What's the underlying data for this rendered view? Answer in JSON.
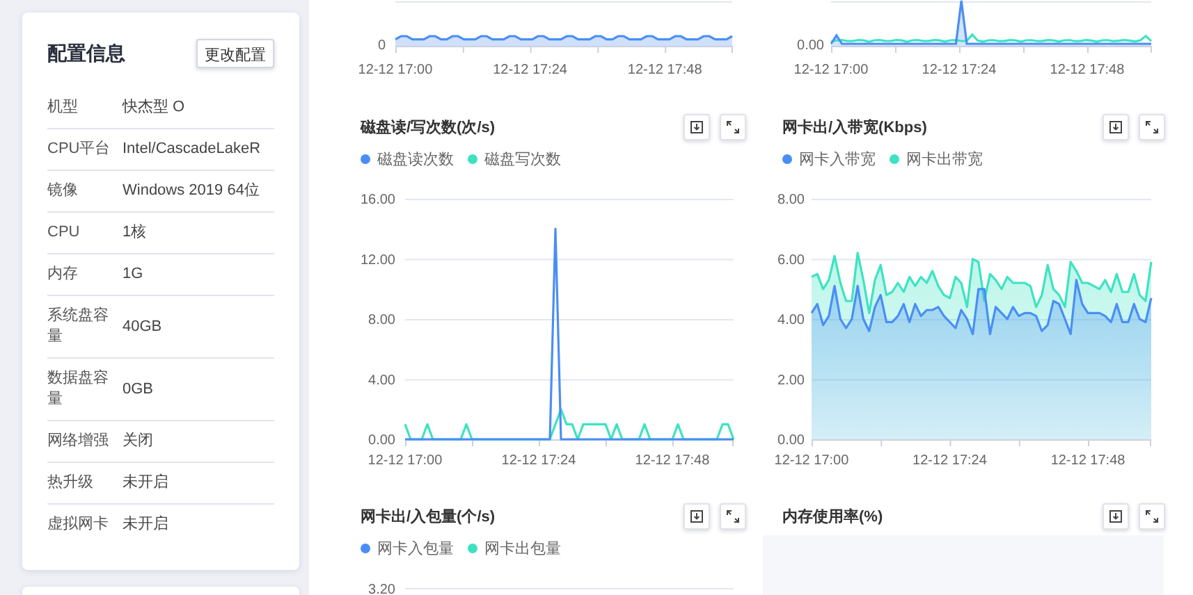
{
  "config_card": {
    "title": "配置信息",
    "edit_button": "更改配置",
    "rows": [
      {
        "label": "机型",
        "value": "快杰型 O"
      },
      {
        "label": "CPU平台",
        "value": "Intel/CascadeLakeR"
      },
      {
        "label": "镜像",
        "value": "Windows 2019 64位"
      },
      {
        "label": "CPU",
        "value": "1核"
      },
      {
        "label": "内存",
        "value": "1G"
      },
      {
        "label": "系统盘容量",
        "value": "40GB"
      },
      {
        "label": "数据盘容量",
        "value": "0GB"
      },
      {
        "label": "网络增强",
        "value": "关闭"
      },
      {
        "label": "热升级",
        "value": "未开启"
      },
      {
        "label": "虚拟网卡",
        "value": "未开启"
      }
    ]
  },
  "charts": [
    {
      "kind": "partial",
      "y_tick": "0",
      "x_ticks": [
        "12-12 17:00",
        "12-12 17:24",
        "12-12 17:48"
      ]
    },
    {
      "kind": "partial",
      "y_tick": "0.00",
      "x_ticks": [
        "12-12 17:00",
        "12-12 17:24",
        "12-12 17:48"
      ]
    },
    {
      "kind": "chart",
      "title": "磁盘读/写次数(次/s)",
      "chart_data": {
        "type": "line",
        "categories": [
          "12-12 17:00",
          null,
          null,
          null,
          null,
          null,
          null,
          null,
          null,
          null,
          null,
          null,
          null,
          null,
          null,
          null,
          null,
          null,
          null,
          null,
          null,
          null,
          null,
          null,
          "12-12 17:24",
          null,
          null,
          null,
          null,
          null,
          null,
          null,
          null,
          null,
          null,
          null,
          null,
          null,
          null,
          null,
          null,
          null,
          null,
          null,
          null,
          null,
          null,
          null,
          "12-12 17:48",
          null,
          null,
          null,
          null,
          null,
          null,
          null,
          null,
          null,
          null,
          null
        ],
        "ylim": [
          0,
          16
        ],
        "stacked": false,
        "grid": true,
        "yticks": [
          {
            "value": 0,
            "label": "0.00"
          },
          {
            "value": 4,
            "label": "4.00"
          },
          {
            "value": 8,
            "label": "8.00"
          },
          {
            "value": 12,
            "label": "12.00"
          },
          {
            "value": 16,
            "label": "16.00"
          }
        ],
        "series": [
          {
            "name": "磁盘读次数",
            "color": "#4a8ef5",
            "values": [
              0,
              0,
              0,
              0,
              0,
              0,
              0,
              0,
              0,
              0,
              0,
              0,
              0,
              0,
              0,
              0,
              0,
              0,
              0,
              0,
              0,
              0,
              0,
              0,
              0,
              0,
              0,
              14,
              0,
              0,
              0,
              0,
              0,
              0,
              0,
              0,
              0,
              0,
              0,
              0,
              0,
              0,
              0,
              0,
              0,
              0,
              0,
              0,
              0,
              0,
              0,
              0,
              0,
              0,
              0,
              0,
              0,
              0,
              0,
              0
            ]
          },
          {
            "name": "磁盘写次数",
            "color": "#3de3c1",
            "values": [
              1,
              0,
              0,
              0,
              1,
              0,
              0,
              0,
              0,
              0,
              0,
              1,
              0,
              0,
              0,
              0,
              0,
              0,
              0,
              0,
              0,
              0,
              0,
              0,
              0,
              0,
              0,
              1,
              2,
              1,
              1,
              0,
              1,
              1,
              1,
              1,
              1,
              0,
              1,
              0,
              0,
              0,
              0,
              1,
              0,
              0,
              0,
              0,
              0,
              1,
              0,
              0,
              0,
              0,
              0,
              0,
              0,
              1,
              1,
              0
            ]
          }
        ]
      }
    },
    {
      "kind": "chart",
      "title": "网卡出/入带宽(Kbps)",
      "chart_data": {
        "type": "area",
        "categories": [
          "12-12 17:00",
          null,
          null,
          null,
          null,
          null,
          null,
          null,
          null,
          null,
          null,
          null,
          null,
          null,
          null,
          null,
          null,
          null,
          null,
          null,
          null,
          null,
          null,
          null,
          "12-12 17:24",
          null,
          null,
          null,
          null,
          null,
          null,
          null,
          null,
          null,
          null,
          null,
          null,
          null,
          null,
          null,
          null,
          null,
          null,
          null,
          null,
          null,
          null,
          null,
          "12-12 17:48",
          null,
          null,
          null,
          null,
          null,
          null,
          null,
          null,
          null,
          null,
          null
        ],
        "ylim": [
          0,
          8
        ],
        "stacked": false,
        "grid": true,
        "yticks": [
          {
            "value": 0,
            "label": "0.00"
          },
          {
            "value": 2,
            "label": "2.00"
          },
          {
            "value": 4,
            "label": "4.00"
          },
          {
            "value": 6,
            "label": "6.00"
          },
          {
            "value": 8,
            "label": "8.00"
          }
        ],
        "series": [
          {
            "name": "网卡入带宽",
            "color": "#4a8ef5",
            "values": [
              4.2,
              4.5,
              3.8,
              4.1,
              5.1,
              4.0,
              3.7,
              4.0,
              5.1,
              4.0,
              3.6,
              4.4,
              4.8,
              3.9,
              3.9,
              4.1,
              4.5,
              3.9,
              4.5,
              4.1,
              4.3,
              4.3,
              4.4,
              4.1,
              3.9,
              3.7,
              4.3,
              4.0,
              3.5,
              5.0,
              5.0,
              3.5,
              4.4,
              4.2,
              4.0,
              4.4,
              4.1,
              4.2,
              4.2,
              4.1,
              3.6,
              3.8,
              4.6,
              4.5,
              4.0,
              3.5,
              5.3,
              4.5,
              4.2,
              4.2,
              4.2,
              4.1,
              3.9,
              4.5,
              3.9,
              3.9,
              4.5,
              4.0,
              3.9,
              4.7
            ]
          },
          {
            "name": "网卡出带宽",
            "color": "#3de3c1",
            "values": [
              5.4,
              5.5,
              5.0,
              5.3,
              6.1,
              5.2,
              4.6,
              4.6,
              6.2,
              5.3,
              4.2,
              5.3,
              5.8,
              4.8,
              4.9,
              5.2,
              4.9,
              5.4,
              5.1,
              5.4,
              5.2,
              5.6,
              5.1,
              4.8,
              4.7,
              5.4,
              5.2,
              4.4,
              6.0,
              5.9,
              4.6,
              5.5,
              5.3,
              5.0,
              5.4,
              5.2,
              5.2,
              5.2,
              5.1,
              4.4,
              4.8,
              5.8,
              5.0,
              4.8,
              4.4,
              5.9,
              5.6,
              5.2,
              5.2,
              5.1,
              5.0,
              5.3,
              4.9,
              5.5,
              4.9,
              4.9,
              5.5,
              4.8,
              4.6,
              5.9
            ]
          }
        ]
      }
    },
    {
      "kind": "cut",
      "title": "网卡出/入包量(个/s)",
      "legend": [
        {
          "label": "网卡入包量",
          "color": "#4a8ef5"
        },
        {
          "label": "网卡出包量",
          "color": "#3de3c1"
        }
      ],
      "y_tick": "3.20"
    },
    {
      "kind": "empty",
      "title": "内存使用率(%)"
    }
  ]
}
